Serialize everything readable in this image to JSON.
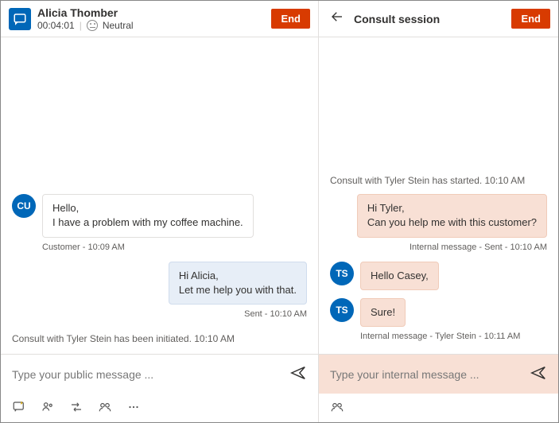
{
  "left": {
    "customer_name": "Alicia Thomber",
    "timer": "00:04:01",
    "sentiment": "Neutral",
    "end_label": "End",
    "customer_avatar": "CU",
    "customer_msg_line1": "Hello,",
    "customer_msg_line2": "I have a problem with my coffee machine.",
    "customer_meta": "Customer - 10:09 AM",
    "agent_msg_line1": "Hi Alicia,",
    "agent_msg_line2": "Let me help you with that.",
    "agent_meta": "Sent - 10:10 AM",
    "system_initiated": "Consult with Tyler Stein has been initiated. 10:10 AM",
    "compose_placeholder": "Type your public message ..."
  },
  "right": {
    "title": "Consult session",
    "end_label": "End",
    "system_started": "Consult with Tyler Stein has started. 10:10 AM",
    "out_msg_line1": "Hi Tyler,",
    "out_msg_line2": "Can you help me with this customer?",
    "out_meta": "Internal message - Sent - 10:10 AM",
    "ts_avatar": "TS",
    "in_msg1": "Hello Casey,",
    "in_msg2": "Sure!",
    "in_meta": "Internal message - Tyler Stein - 10:11 AM",
    "compose_placeholder": "Type your internal message ..."
  }
}
